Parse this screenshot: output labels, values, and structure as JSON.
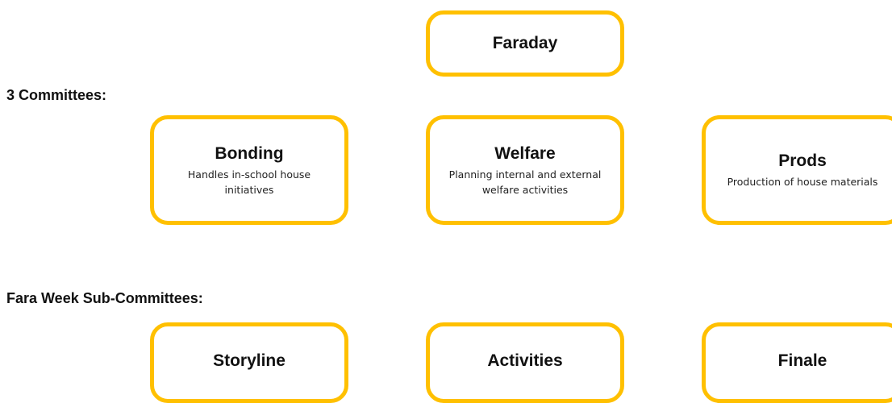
{
  "root": {
    "title": "Faraday"
  },
  "committees_section": {
    "label": "3 Committees:",
    "items": [
      {
        "title": "Bonding",
        "description": "Handles in-school house initiatives"
      },
      {
        "title": "Welfare",
        "description": "Planning internal and external welfare activities"
      },
      {
        "title": "Prods",
        "description": "Production of house materials"
      }
    ]
  },
  "subcommittees_section": {
    "label": "Fara Week Sub-Committees:",
    "items": [
      {
        "title": "Storyline"
      },
      {
        "title": "Activities"
      },
      {
        "title": "Finale"
      }
    ]
  },
  "colors": {
    "box_border": "#FFC000",
    "text": "#111111",
    "background": "#FFFFFF"
  }
}
